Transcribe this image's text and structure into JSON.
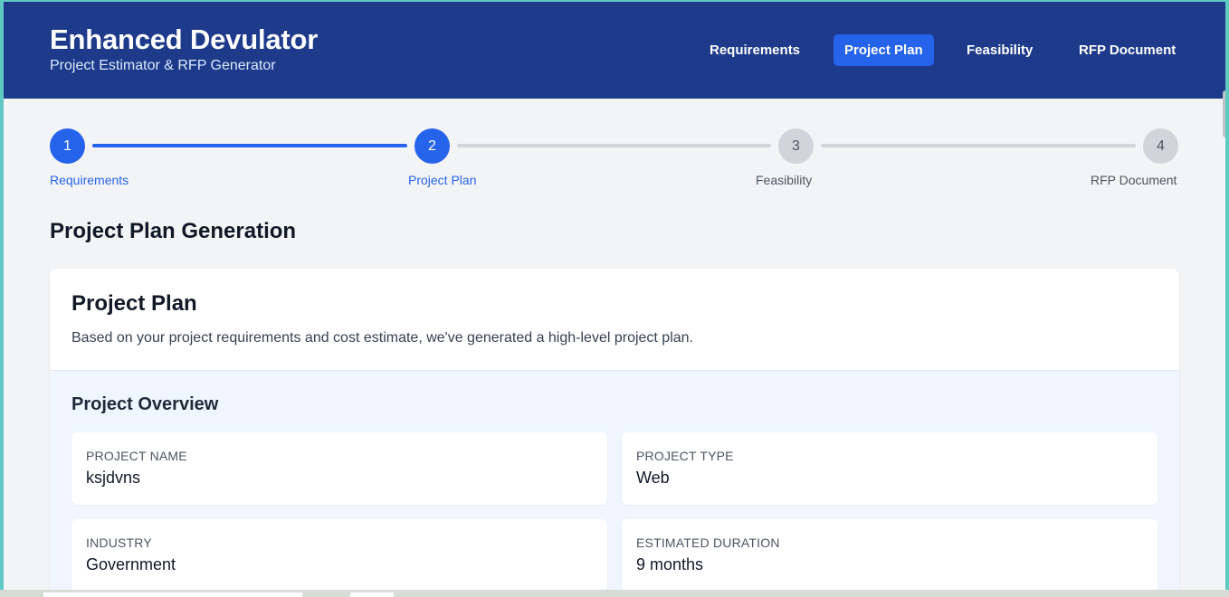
{
  "app": {
    "title": "Enhanced Devulator",
    "subtitle": "Project Estimator & RFP Generator"
  },
  "nav": {
    "items": [
      {
        "label": "Requirements",
        "active": false
      },
      {
        "label": "Project Plan",
        "active": true
      },
      {
        "label": "Feasibility",
        "active": false
      },
      {
        "label": "RFP Document",
        "active": false
      }
    ]
  },
  "stepper": {
    "steps": [
      {
        "number": "1",
        "label": "Requirements",
        "state": "complete"
      },
      {
        "number": "2",
        "label": "Project Plan",
        "state": "current"
      },
      {
        "number": "3",
        "label": "Feasibility",
        "state": "pending"
      },
      {
        "number": "4",
        "label": "RFP Document",
        "state": "pending"
      }
    ]
  },
  "main": {
    "section_title": "Project Plan Generation",
    "card": {
      "title": "Project Plan",
      "description": "Based on your project requirements and cost estimate, we've generated a high-level project plan."
    },
    "overview": {
      "title": "Project Overview",
      "fields": [
        {
          "label": "PROJECT NAME",
          "value": "ksjdvns"
        },
        {
          "label": "PROJECT TYPE",
          "value": "Web"
        },
        {
          "label": "INDUSTRY",
          "value": "Government"
        },
        {
          "label": "ESTIMATED DURATION",
          "value": "9 months"
        }
      ]
    }
  },
  "colors": {
    "header_bg": "#1e3a8a",
    "accent": "#2563eb",
    "pending": "#d1d5db",
    "overview_bg": "#eff6ff"
  }
}
